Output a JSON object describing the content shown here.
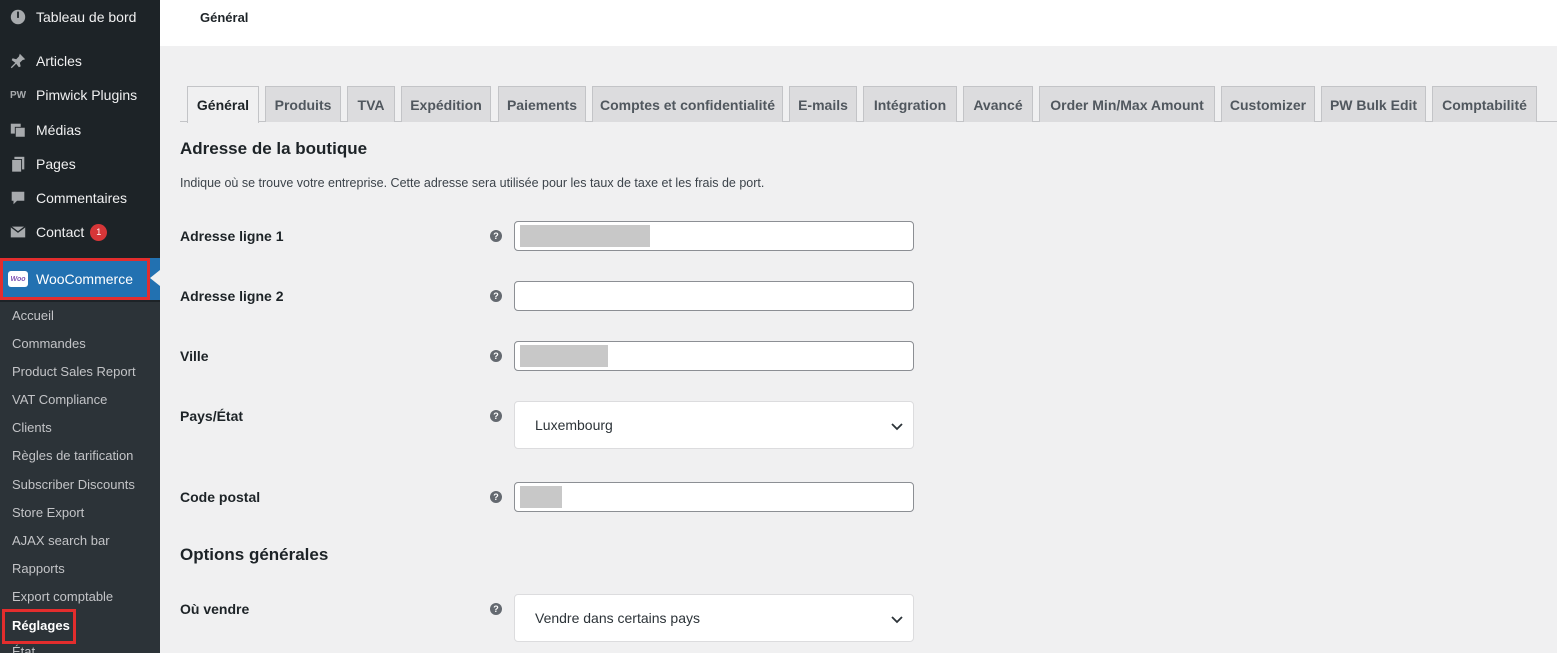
{
  "sidebar": {
    "items": [
      {
        "label": "Tableau de bord",
        "icon": "dashboard-icon"
      },
      {
        "label": "Articles",
        "icon": "pin-icon"
      },
      {
        "label": "Pimwick Plugins",
        "icon": "pimwick-icon"
      },
      {
        "label": "Médias",
        "icon": "media-icon"
      },
      {
        "label": "Pages",
        "icon": "pages-icon"
      },
      {
        "label": "Commentaires",
        "icon": "comment-icon"
      },
      {
        "label": "Contact",
        "icon": "mail-icon",
        "badge": "1"
      }
    ],
    "woocommerce": {
      "label": "WooCommerce",
      "logo_text": "Woo"
    },
    "submenu": [
      "Accueil",
      "Commandes",
      "Product Sales Report",
      "VAT Compliance",
      "Clients",
      "Règles de tarification",
      "Subscriber Discounts",
      "Store Export",
      "AJAX search bar",
      "Rapports",
      "Export comptable",
      "Réglages",
      "État"
    ],
    "active_submenu": "Réglages"
  },
  "header": {
    "title": "Général"
  },
  "tabs": [
    "Général",
    "Produits",
    "TVA",
    "Expédition",
    "Paiements",
    "Comptes et confidentialité",
    "E-mails",
    "Intégration",
    "Avancé",
    "Order Min/Max Amount",
    "Customizer",
    "PW Bulk Edit",
    "Comptabilité"
  ],
  "active_tab": "Général",
  "store_address": {
    "heading": "Adresse de la boutique",
    "description": "Indique où se trouve votre entreprise. Cette adresse sera utilisée pour les taux de taxe et les frais de port.",
    "fields": {
      "address1": {
        "label": "Adresse ligne 1"
      },
      "address2": {
        "label": "Adresse ligne 2"
      },
      "city": {
        "label": "Ville"
      },
      "country": {
        "label": "Pays/État",
        "value": "Luxembourg"
      },
      "postcode": {
        "label": "Code postal"
      }
    }
  },
  "general_options": {
    "heading": "Options générales",
    "sell_where": {
      "label": "Où vendre",
      "value": "Vendre dans certains pays"
    }
  },
  "help_glyph": "?",
  "colors": {
    "sidebar_bg": "#1d2327",
    "accent": "#2271b1",
    "highlight_box": "#e32d2d",
    "badge": "#d63638"
  }
}
